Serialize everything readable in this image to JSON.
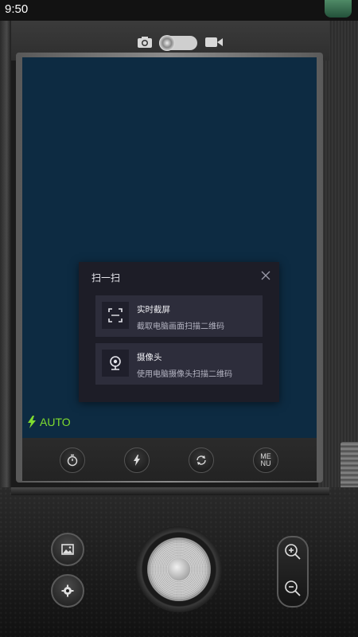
{
  "status_bar": {
    "time": "9:50"
  },
  "flash": {
    "mode": "AUTO",
    "color": "#7fdc2f"
  },
  "controls": {
    "menu_label": "ME\nNU"
  },
  "dialog": {
    "title": "扫一扫",
    "options": [
      {
        "title": "实时截屏",
        "subtitle": "截取电脑画面扫描二维码",
        "icon": "scan-frame-icon"
      },
      {
        "title": "摄像头",
        "subtitle": "使用电脑摄像头扫描二维码",
        "icon": "webcam-icon"
      }
    ]
  },
  "colors": {
    "viewfinder": "#0d2b42",
    "dialog_bg": "#1d1d27",
    "option_bg": "#2d2d3b"
  }
}
